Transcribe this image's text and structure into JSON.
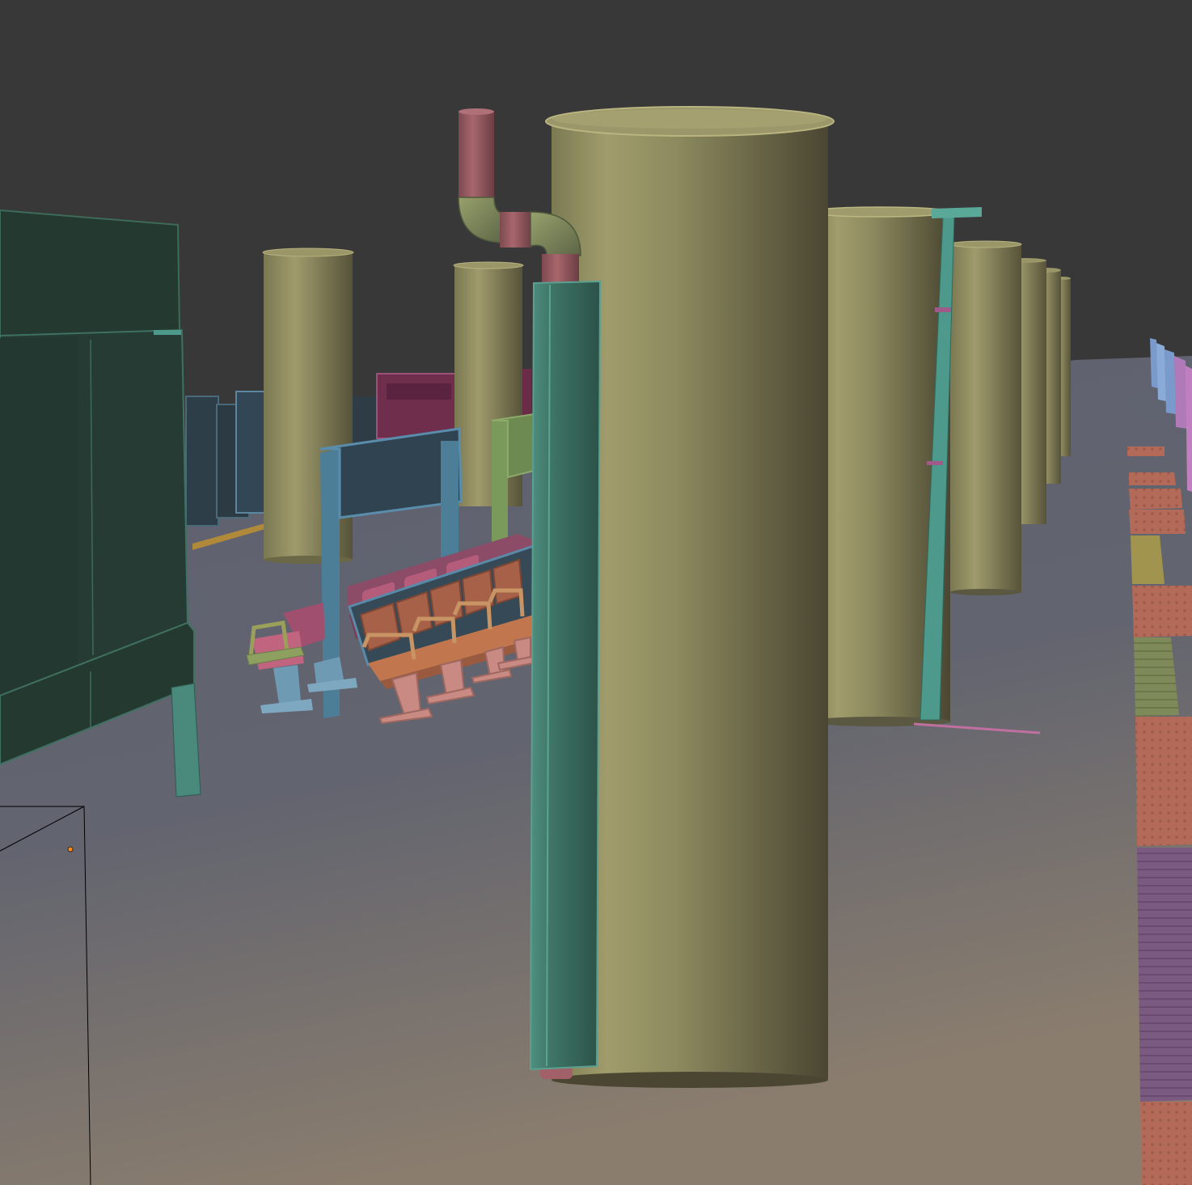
{
  "viewport": {
    "kind": "3d-viewport",
    "shading": "solid-random-color",
    "background_color": "#383838",
    "floor_color_top": "#5f6272",
    "floor_color_bottom": "#8a7a6a"
  },
  "scene_objects": [
    {
      "name": "big-column",
      "color": "#8e8c5c"
    },
    {
      "name": "column-row-right",
      "color": "#8a8858",
      "count": 5
    },
    {
      "name": "column-row-left",
      "color": "#86835a",
      "count": 2
    },
    {
      "name": "drain-pipe",
      "color": "#9a5c62"
    },
    {
      "name": "pipe-elbow",
      "color": "#7e8a5c"
    },
    {
      "name": "teal-post",
      "color": "#3f7a6c"
    },
    {
      "name": "thin-pole",
      "color": "#4d9a8c"
    },
    {
      "name": "sign-board-left",
      "color": "#27403a"
    },
    {
      "name": "sign-frame-blue",
      "color": "#4a7c98"
    },
    {
      "name": "bench-row-orange",
      "color": "#b8745a"
    },
    {
      "name": "bench-row-pink",
      "color": "#9a5470"
    },
    {
      "name": "single-chair",
      "color": "#b05c78"
    },
    {
      "name": "tactile-strip",
      "color": "#b96a58"
    },
    {
      "name": "railing-right",
      "color": "#c080b8"
    },
    {
      "name": "camera-frustum",
      "color": "#000000"
    },
    {
      "name": "origin-dot",
      "color": "#ff8c1a"
    }
  ]
}
